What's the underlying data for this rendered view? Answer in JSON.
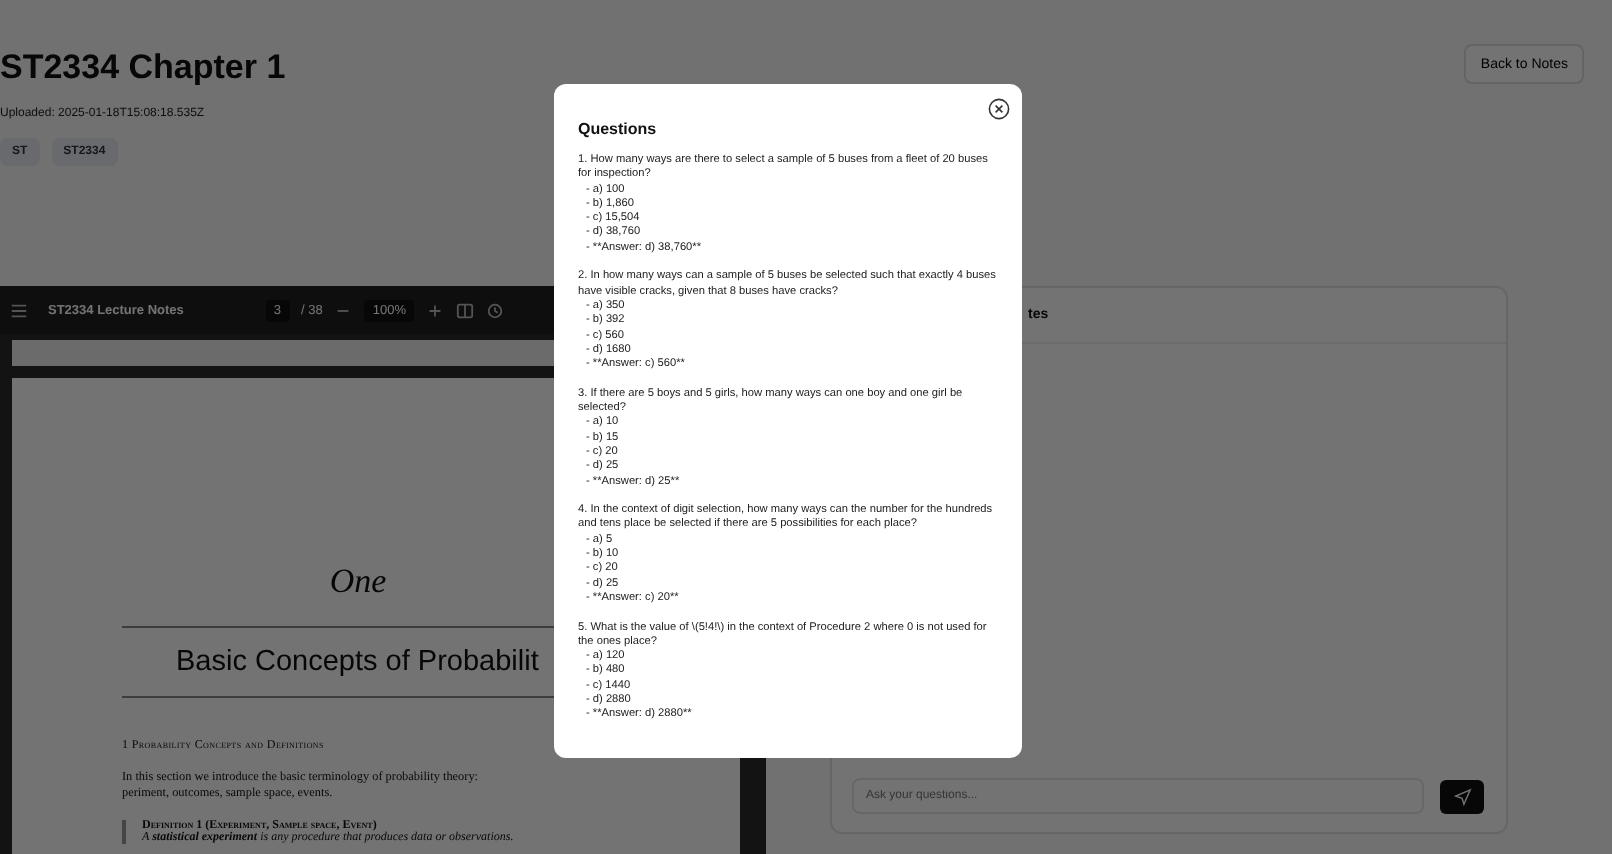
{
  "header": {
    "title": "ST2334 Chapter 1",
    "uploaded": "Uploaded: 2025-01-18T15:08:18.535Z",
    "tags": [
      "ST",
      "ST2334"
    ],
    "back_button": "Back to Notes"
  },
  "pdf_viewer": {
    "document_title": "ST2334 Lecture Notes",
    "page": "3",
    "page_total": "/ 38",
    "zoom": "100%",
    "chapter_number": "One",
    "chapter_title": "Basic Concepts of Probabilit",
    "section": "1   Probability Concepts and Definitions",
    "paragraph": "In this section we introduce the basic terminology of probability theory:\nperiment, outcomes, sample space, events.",
    "definition_title": "Definition 1 (Experiment, Sample space, Event)",
    "definition_text": "A **statistical experiment** is any procedure that produces data or observations."
  },
  "chat": {
    "title": "tes",
    "placeholder": "Ask your questions..."
  },
  "modal": {
    "title": "Questions",
    "questions": [
      {
        "text": "1. How many ways are there to select a sample of 5 buses from a fleet of 20 buses for inspection?",
        "options": [
          "- a) 100",
          "- b) 1,860",
          "- c) 15,504",
          "- d) 38,760"
        ],
        "answer": "- **Answer: d) 38,760**"
      },
      {
        "text": "2. In how many ways can a sample of 5 buses be selected such that exactly 4 buses have visible cracks, given that 8 buses have cracks?",
        "options": [
          "- a) 350",
          "- b) 392",
          "- c) 560",
          "- d) 1680"
        ],
        "answer": "- **Answer: c) 560**"
      },
      {
        "text": "3. If there are 5 boys and 5 girls, how many ways can one boy and one girl be selected?",
        "options": [
          "- a) 10",
          "- b) 15",
          "- c) 20",
          "- d) 25"
        ],
        "answer": "- **Answer: d) 25**"
      },
      {
        "text": "4. In the context of digit selection, how many ways can the number for the hundreds and tens place be selected if there are 5 possibilities for each place?",
        "options": [
          "- a) 5",
          "- b) 10",
          "- c) 20",
          "- d) 25"
        ],
        "answer": "- **Answer: c) 20**"
      },
      {
        "text": "5. What is the value of \\(5!4!\\) in the context of Procedure 2 where 0 is not used for the ones place?",
        "options": [
          "- a) 120",
          "- b) 480",
          "- c) 1440",
          "- d) 2880"
        ],
        "answer": "- **Answer: d) 2880**"
      }
    ]
  }
}
